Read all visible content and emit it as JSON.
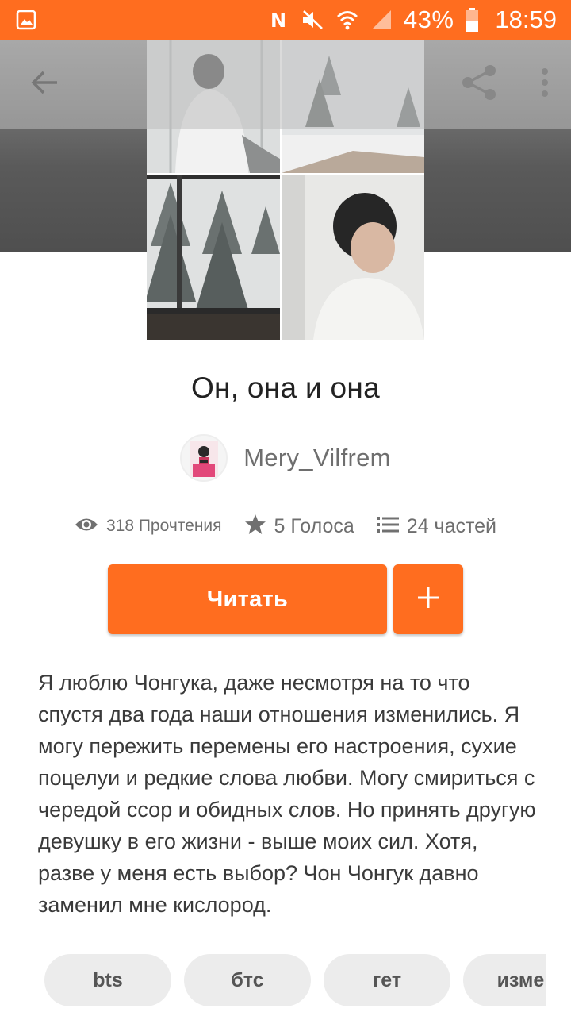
{
  "status_bar": {
    "battery": "43%",
    "time": "18:59",
    "icons": [
      "gallery-icon",
      "nfc-icon",
      "mute-icon",
      "wifi-icon",
      "signal-icon",
      "battery-icon"
    ],
    "background_color": "#ff6d1f"
  },
  "toolbar": {
    "icons": [
      "back-arrow-icon",
      "share-icon",
      "more-vertical-icon"
    ]
  },
  "story": {
    "title": "Он, она и она",
    "author": "Mery_Vilfrem",
    "stats": {
      "reads": "318 Прочтения",
      "votes": "5 Голоса",
      "parts": "24 частей"
    },
    "read_button": "Читать",
    "add_button_icon": "plus-icon",
    "description": "Я люблю Чонгука, даже несмотря на то что спустя два года наши отношения изменились. Я могу пережить перемены его настроения, сухие поцелуи и редкие слова любви. Могу смириться с чередой ссор и обидных слов. Но принять другую девушку в его жизни - выше моих сил. Хотя, разве у меня есть выбор? Чон Чонгук давно заменил мне кислород.",
    "tags": [
      "bts",
      "бтс",
      "гет",
      "измен"
    ]
  },
  "colors": {
    "accent": "#ff6d1f",
    "tag_bg": "#ececec"
  }
}
